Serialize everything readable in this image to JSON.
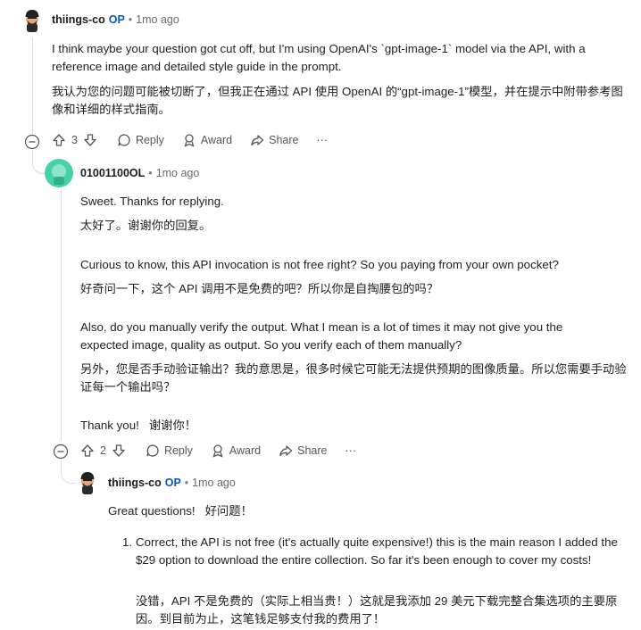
{
  "comment1": {
    "author": "thiings-co",
    "op_badge": "OP",
    "separator": "•",
    "time": "1mo ago",
    "body_en": "I think maybe your question got cut off, but I'm using OpenAI's `gpt-image-1` model via the API, with a reference image and detailed style guide in the prompt.",
    "body_zh": "我认为您的问题可能被切断了，但我正在通过 API 使用 OpenAI 的“gpt-image-1”模型，并在提示中附带参考图像和详细的样式指南。",
    "votes": "3",
    "reply": "Reply",
    "award": "Award",
    "share": "Share",
    "more": "···"
  },
  "comment2": {
    "author": "01001100OL",
    "separator": "•",
    "time": "1mo ago",
    "p1_en": "Sweet. Thanks for replying.",
    "p1_zh": "太好了。谢谢你的回复。",
    "p2_en": "Curious to know, this API invocation is not free right? So you paying from your own pocket?",
    "p2_zh": "好奇问一下，这个 API 调用不是免费的吧？所以你是自掏腰包的吗？",
    "p3_en": "Also, do you manually verify the output. What I mean is a lot of times it may not give you the expected image, quality as output. So you verify each of them manually?",
    "p3_zh": "另外，您是否手动验证输出？我的意思是，很多时候它可能无法提供预期的图像质量。所以您需要手动验证每一个输出吗？",
    "p4": "Thank you!   谢谢你！",
    "votes": "2",
    "reply": "Reply",
    "award": "Award",
    "share": "Share",
    "more": "···"
  },
  "comment3": {
    "author": "thiings-co",
    "op_badge": "OP",
    "separator": "•",
    "time": "1mo ago",
    "intro": "Great questions!   好问题！",
    "item1_num": "1.",
    "item1_en": "Correct, the API is not free (it's actually quite expensive!) this is the main reason I added the $29 option to download the entire collection. So far it's been enough to cover my costs!",
    "item1_zh": "没错，API 不是免费的（实际上相当贵！）这就是我添加 29 美元下载完整合集选项的主要原因。到目前为止，这笔钱足够支付我的费用了！"
  }
}
